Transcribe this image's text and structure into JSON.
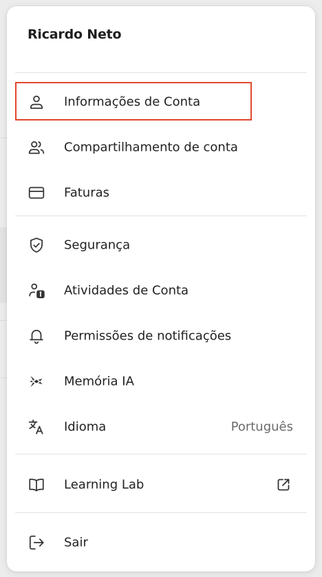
{
  "profile": {
    "name": "Ricardo Neto"
  },
  "menu": {
    "items": [
      {
        "label": "Informações de Conta",
        "icon": "person-icon",
        "highlighted": true
      },
      {
        "label": "Compartilhamento de conta",
        "icon": "people-icon"
      },
      {
        "label": "Faturas",
        "icon": "credit-card-icon"
      },
      {
        "label": "Segurança",
        "icon": "shield-check-icon"
      },
      {
        "label": "Atividades de Conta",
        "icon": "person-info-icon"
      },
      {
        "label": "Permissões de notificações",
        "icon": "bell-icon"
      },
      {
        "label": "Memória IA",
        "icon": "ai-memory-icon"
      },
      {
        "label": "Idioma",
        "icon": "translate-icon",
        "value": "Português"
      },
      {
        "label": "Learning Lab",
        "icon": "book-icon",
        "trailing_icon": "external-link-icon"
      },
      {
        "label": "Sair",
        "icon": "logout-icon"
      }
    ]
  },
  "colors": {
    "highlight_border": "#e0472e",
    "text_primary": "#222222",
    "text_secondary": "#6b6b6b"
  }
}
